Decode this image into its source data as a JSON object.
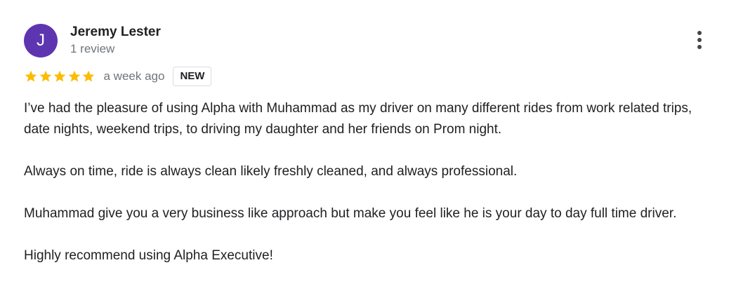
{
  "reviewer": {
    "initial": "J",
    "name": "Jeremy Lester",
    "review_count": "1 review",
    "avatar_color": "#5e35b1"
  },
  "rating": {
    "stars": 5,
    "max_stars": 5,
    "star_color": "#fbbc04",
    "time_ago": "a week ago",
    "badge": "NEW"
  },
  "review": {
    "paragraphs": [
      "I’ve had the pleasure of using Alpha with Muhammad as my driver on many different rides from work related trips, date nights, weekend trips, to driving my daughter and her friends on Prom night.",
      "Always on time, ride is always clean likely freshly cleaned, and always professional.",
      "Muhammad give you a very business like approach but make you feel like he is your day to day full time driver.",
      "Highly recommend using Alpha Executive!"
    ]
  },
  "icons": {
    "more": "more-vert-icon",
    "star": "star-icon"
  }
}
